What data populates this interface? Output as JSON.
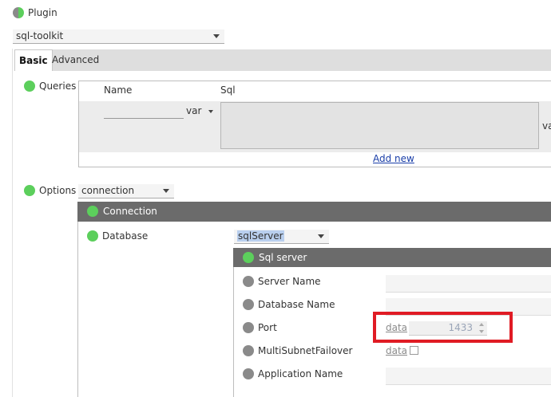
{
  "plugin": {
    "label": "Plugin",
    "select_value": "sql-toolkit"
  },
  "tabs": [
    {
      "label": "Basic"
    },
    {
      "label": "Advanced"
    }
  ],
  "queries": {
    "label": "Queries",
    "col_name": "Name",
    "col_sql": "Sql",
    "var_label": "var",
    "var_label_right": "va",
    "add_new": "Add new"
  },
  "options": {
    "label": "Options",
    "select_value": "connection"
  },
  "connection": {
    "header": "Connection",
    "database_label": "Database",
    "database_value": "sqlServer"
  },
  "sql_server": {
    "header": "Sql server",
    "fields": [
      {
        "label": "Server Name"
      },
      {
        "label": "Database Name"
      },
      {
        "label": "Port",
        "data_link": "data",
        "value": "1433"
      },
      {
        "label": "MultiSubnetFailover",
        "data_link": "data"
      },
      {
        "label": "Application Name"
      }
    ]
  },
  "highlight_color": "#e01b24"
}
